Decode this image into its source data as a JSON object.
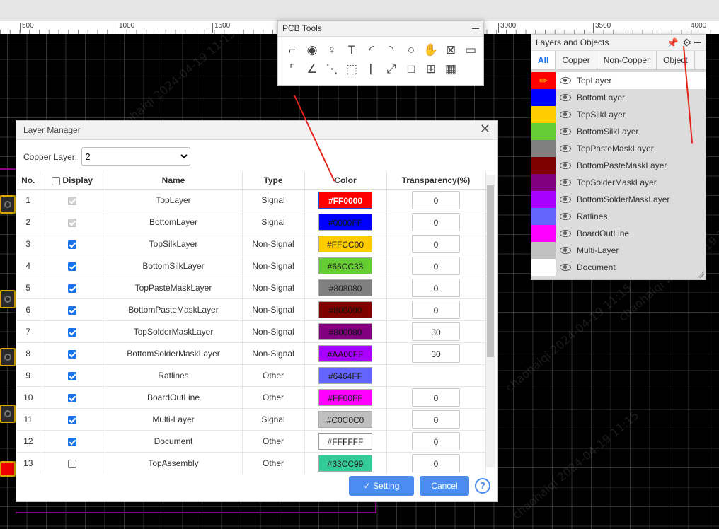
{
  "ruler": {
    "marks": [
      "500",
      "1000",
      "1500",
      "3000",
      "3500",
      "4000"
    ]
  },
  "watermark": "chaohaiqi  2024-04-19  11:15",
  "pcb_tools": {
    "title": "PCB Tools"
  },
  "layers_panel": {
    "title": "Layers and Objects",
    "tabs": [
      "All",
      "Copper",
      "Non-Copper",
      "Object"
    ],
    "items": [
      {
        "name": "TopLayer",
        "color": "#FF0000"
      },
      {
        "name": "BottomLayer",
        "color": "#0000FF"
      },
      {
        "name": "TopSilkLayer",
        "color": "#FFCC00"
      },
      {
        "name": "BottomSilkLayer",
        "color": "#66CC33"
      },
      {
        "name": "TopPasteMaskLayer",
        "color": "#808080"
      },
      {
        "name": "BottomPasteMaskLayer",
        "color": "#800000"
      },
      {
        "name": "TopSolderMaskLayer",
        "color": "#800080"
      },
      {
        "name": "BottomSolderMaskLayer",
        "color": "#AA00FF"
      },
      {
        "name": "Ratlines",
        "color": "#6464FF"
      },
      {
        "name": "BoardOutLine",
        "color": "#FF00FF"
      },
      {
        "name": "Multi-Layer",
        "color": "#C0C0C0"
      },
      {
        "name": "Document",
        "color": "#FFFFFF"
      }
    ]
  },
  "dialog": {
    "title": "Layer Manager",
    "copper_label": "Copper Layer:",
    "copper_value": "2",
    "headers": {
      "no": "No.",
      "display": "Display",
      "name": "Name",
      "type": "Type",
      "color": "Color",
      "transparency": "Transparency(%)"
    },
    "rows": [
      {
        "no": "1",
        "display": "disabled",
        "name": "TopLayer",
        "type": "Signal",
        "color": "#FF0000",
        "text": "#FF0000",
        "transparency": "0"
      },
      {
        "no": "2",
        "display": "disabled",
        "name": "BottomLayer",
        "type": "Signal",
        "color": "#0000FF",
        "text": "#0000FF",
        "transparency": "0"
      },
      {
        "no": "3",
        "display": "on",
        "name": "TopSilkLayer",
        "type": "Non-Signal",
        "color": "#FFCC00",
        "text": "#FFCC00",
        "transparency": "0"
      },
      {
        "no": "4",
        "display": "on",
        "name": "BottomSilkLayer",
        "type": "Non-Signal",
        "color": "#66CC33",
        "text": "#66CC33",
        "transparency": "0"
      },
      {
        "no": "5",
        "display": "on",
        "name": "TopPasteMaskLayer",
        "type": "Non-Signal",
        "color": "#808080",
        "text": "#808080",
        "transparency": "0"
      },
      {
        "no": "6",
        "display": "on",
        "name": "BottomPasteMaskLayer",
        "type": "Non-Signal",
        "color": "#800000",
        "text": "#800000",
        "transparency": "0"
      },
      {
        "no": "7",
        "display": "on",
        "name": "TopSolderMaskLayer",
        "type": "Non-Signal",
        "color": "#800080",
        "text": "#800080",
        "transparency": "30"
      },
      {
        "no": "8",
        "display": "on",
        "name": "BottomSolderMaskLayer",
        "type": "Non-Signal",
        "color": "#AA00FF",
        "text": "#AA00FF",
        "transparency": "30"
      },
      {
        "no": "9",
        "display": "on",
        "name": "Ratlines",
        "type": "Other",
        "color": "#6464FF",
        "text": "#6464FF",
        "transparency": ""
      },
      {
        "no": "10",
        "display": "on",
        "name": "BoardOutLine",
        "type": "Other",
        "color": "#FF00FF",
        "text": "#FF00FF",
        "transparency": "0"
      },
      {
        "no": "11",
        "display": "on",
        "name": "Multi-Layer",
        "type": "Signal",
        "color": "#C0C0C0",
        "text": "#C0C0C0",
        "transparency": "0"
      },
      {
        "no": "12",
        "display": "on",
        "name": "Document",
        "type": "Other",
        "color": "#FFFFFF",
        "text": "#FFFFFF",
        "transparency": "0"
      },
      {
        "no": "13",
        "display": "off",
        "name": "TopAssembly",
        "type": "Other",
        "color": "#33CC99",
        "text": "#33CC99",
        "transparency": "0"
      }
    ],
    "setting_label": "Setting",
    "cancel_label": "Cancel",
    "help_label": "?"
  }
}
